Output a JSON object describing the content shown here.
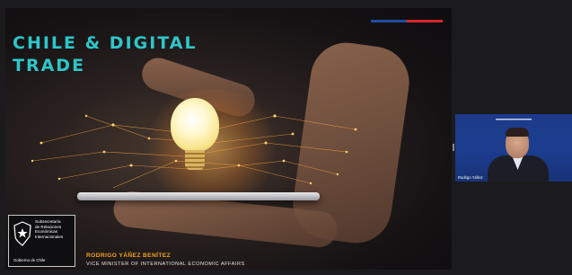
{
  "slide": {
    "title_line1": "CHILE & DIGITAL",
    "title_line2": "TRADE",
    "logo": {
      "org_line1": "Subsecretaría",
      "org_line2": "de Relaciones",
      "org_line3": "Económicas",
      "org_line4": "Internacionales",
      "gov": "Gobierno de Chile"
    },
    "speaker_name": "RODRIGO YÁÑEZ BENÍTEZ",
    "speaker_role": "VICE MINISTER OF INTERNATIONAL ECONOMIC AFFAIRS"
  },
  "video_tile": {
    "participant_name": "Rodrigo Yáñez"
  },
  "colors": {
    "title": "#2ec6c9",
    "speaker_name": "#f3a21f",
    "accent_blue": "#1f4ea0",
    "accent_red": "#d8262e",
    "video_bg": "#1d3b8a"
  }
}
